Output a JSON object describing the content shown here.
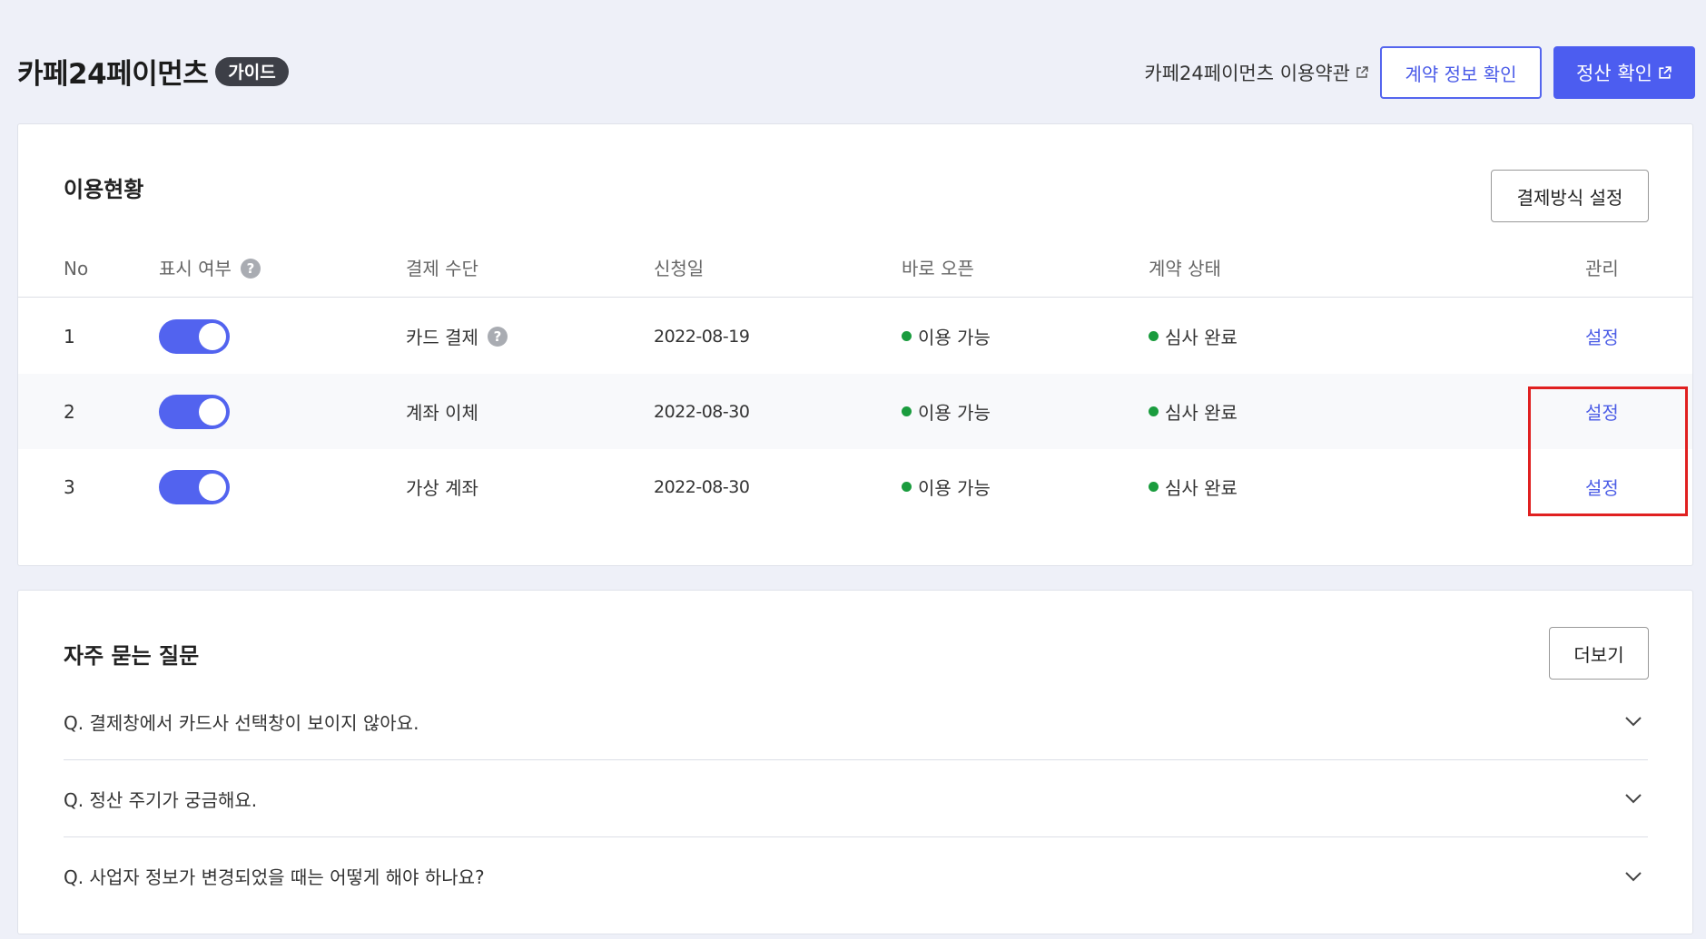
{
  "header": {
    "brand_title": "카페24페이먼츠",
    "guide_badge": "가이드",
    "terms_link": "카페24페이먼츠 이용약관",
    "contract_button": "계약 정보 확인",
    "settlement_button": "정산 확인"
  },
  "usage": {
    "title": "이용현황",
    "payment_method_button": "결제방식 설정",
    "columns": {
      "no": "No",
      "display": "표시 여부",
      "method": "결제 수단",
      "applied_date": "신청일",
      "quick_open": "바로 오픈",
      "contract_status": "계약 상태",
      "manage": "관리"
    },
    "help_glyph": "?",
    "rows": [
      {
        "no": "1",
        "display_on": true,
        "method": "카드 결제",
        "method_help": true,
        "applied_date": "2022-08-19",
        "quick_open": "이용 가능",
        "contract_status": "심사 완료",
        "manage": "설정"
      },
      {
        "no": "2",
        "display_on": true,
        "method": "계좌 이체",
        "method_help": false,
        "applied_date": "2022-08-30",
        "quick_open": "이용 가능",
        "contract_status": "심사 완료",
        "manage": "설정"
      },
      {
        "no": "3",
        "display_on": true,
        "method": "가상 계좌",
        "method_help": false,
        "applied_date": "2022-08-30",
        "quick_open": "이용 가능",
        "contract_status": "심사 완료",
        "manage": "설정"
      }
    ]
  },
  "faq": {
    "title": "자주 묻는 질문",
    "more_button": "더보기",
    "items": [
      "Q. 결제창에서 카드사 선택창이 보이지 않아요.",
      "Q. 정산 주기가 궁금해요.",
      "Q. 사업자 정보가 변경되었을 때는 어떻게 해야 하나요?"
    ]
  },
  "colors": {
    "accent": "#4c5df0",
    "status_green": "#1a9c3e",
    "highlight_red": "#e02020",
    "background": "#eef0f8"
  },
  "icons": {
    "external": "external-link-icon",
    "help": "help-icon",
    "chevron": "chevron-down-icon",
    "status": "status-dot-icon"
  }
}
